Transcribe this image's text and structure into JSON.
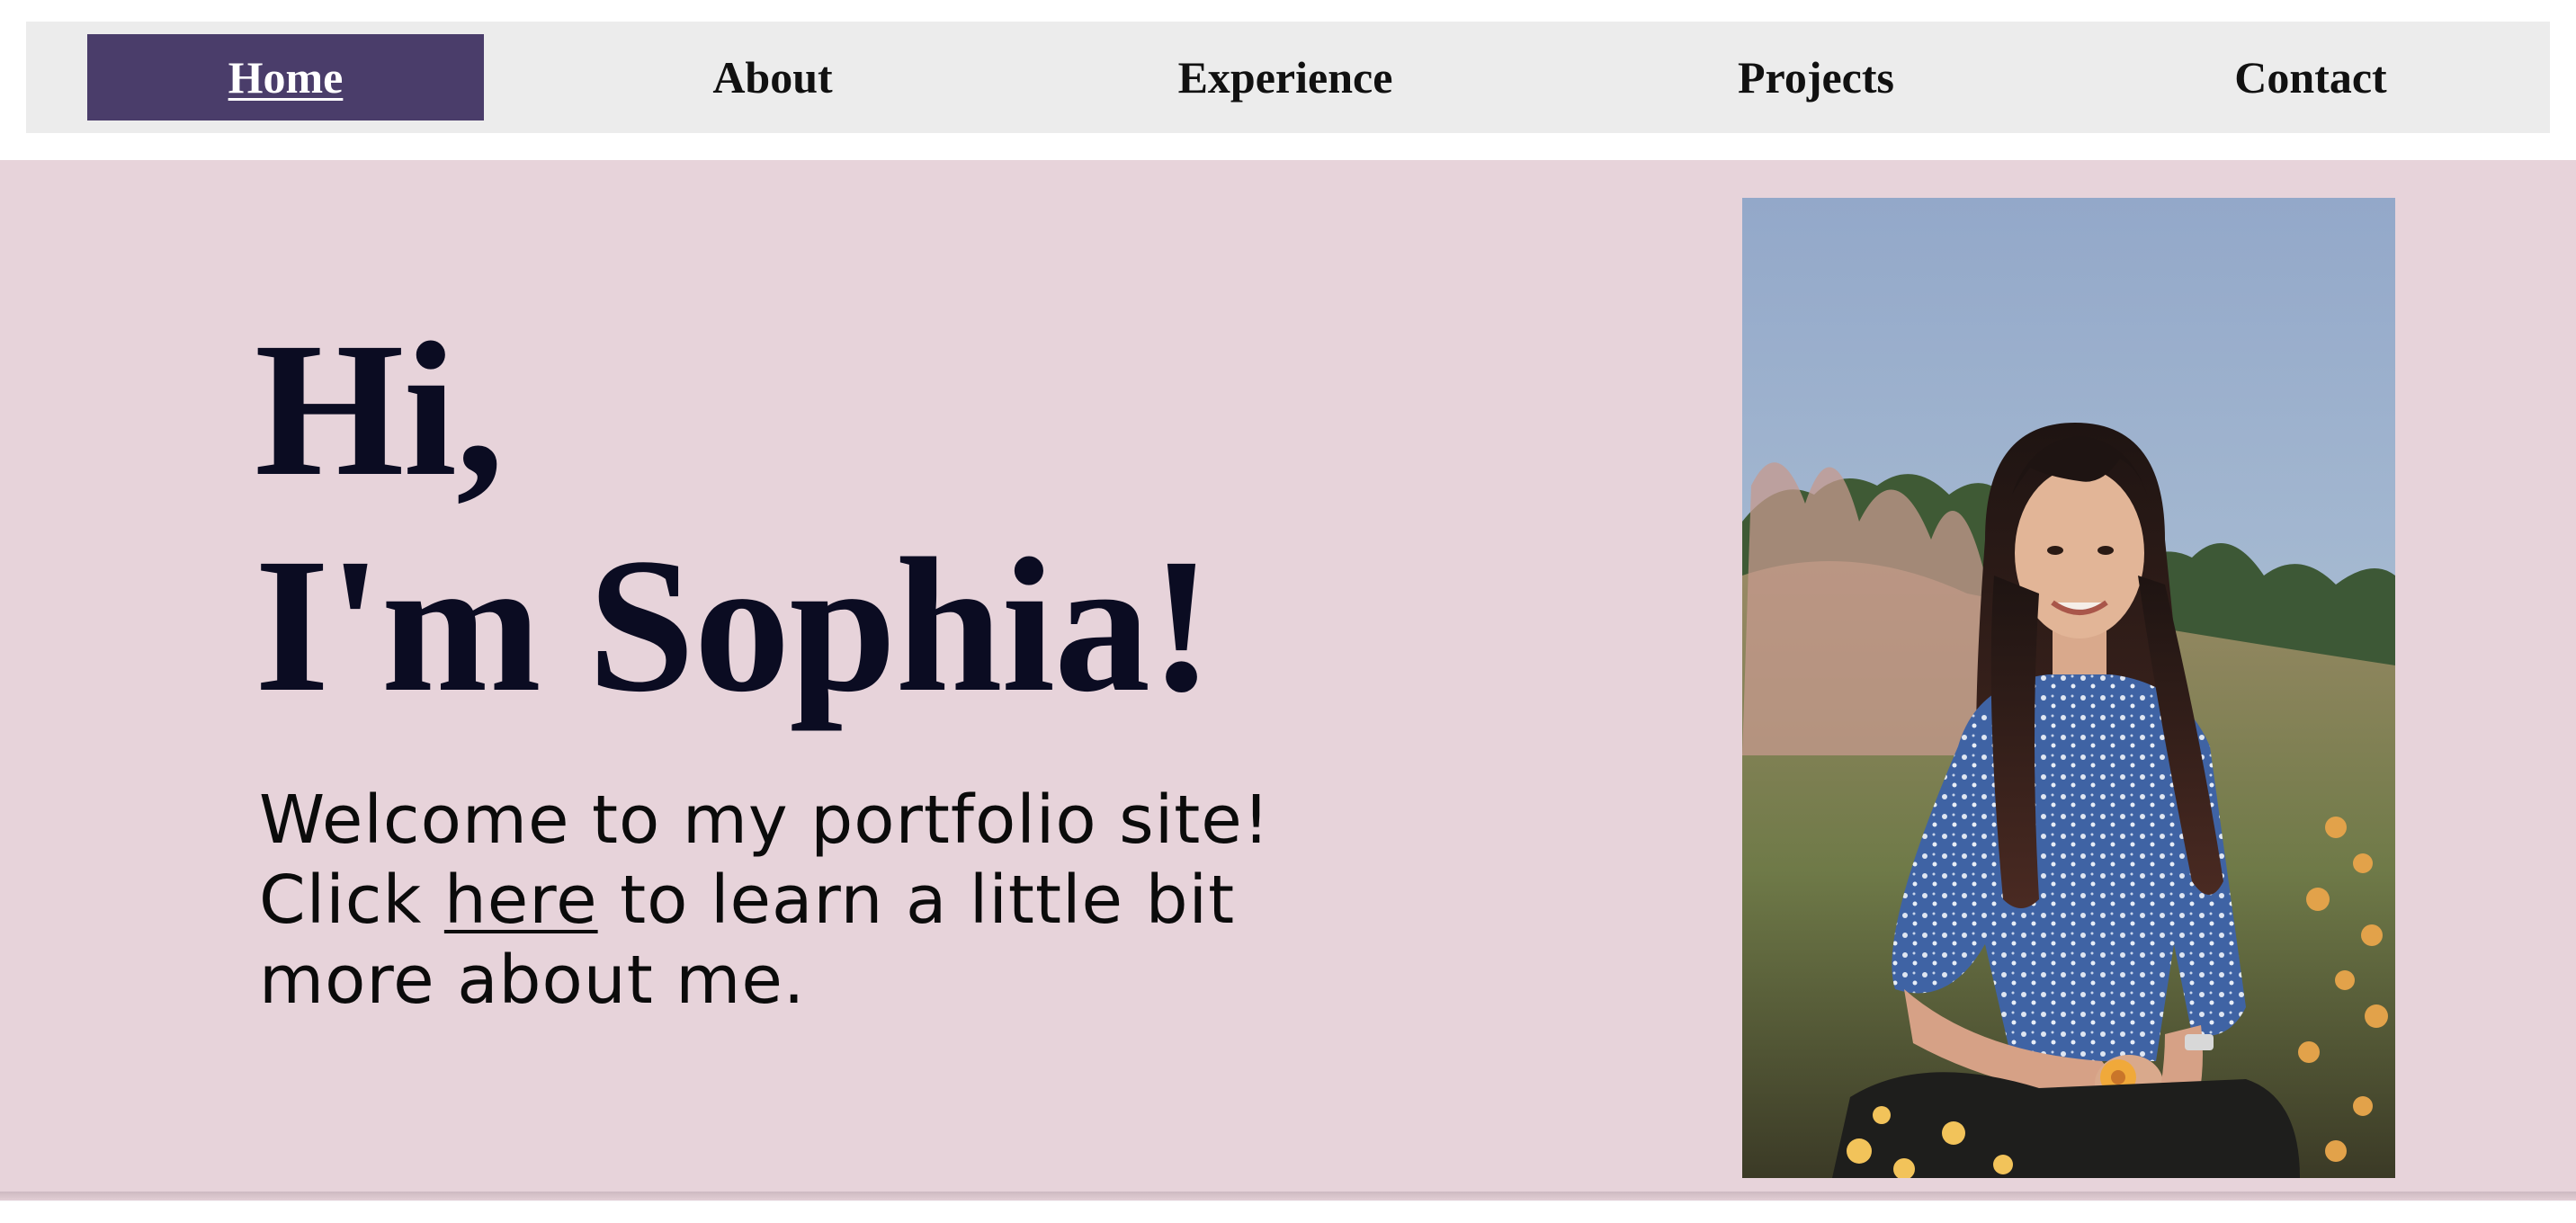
{
  "nav": {
    "items": [
      {
        "label": "Home",
        "active": true
      },
      {
        "label": "About",
        "active": false
      },
      {
        "label": "Experience",
        "active": false
      },
      {
        "label": "Projects",
        "active": false
      },
      {
        "label": "Contact",
        "active": false
      }
    ]
  },
  "hero": {
    "greeting_line1": "Hi,",
    "greeting_line2": "I'm Sophia!",
    "welcome_line1": "Welcome to my portfolio site!",
    "click_prefix": "Click ",
    "link_text": "here",
    "click_suffix": " to learn a little bit",
    "welcome_line3": "more about me."
  },
  "colors": {
    "nav_background": "#ececec",
    "nav_active": "#4a3d6a",
    "hero_background": "#e7d3da",
    "heading_text": "#0b0c22"
  },
  "photo": {
    "icon": "portrait-photo"
  }
}
